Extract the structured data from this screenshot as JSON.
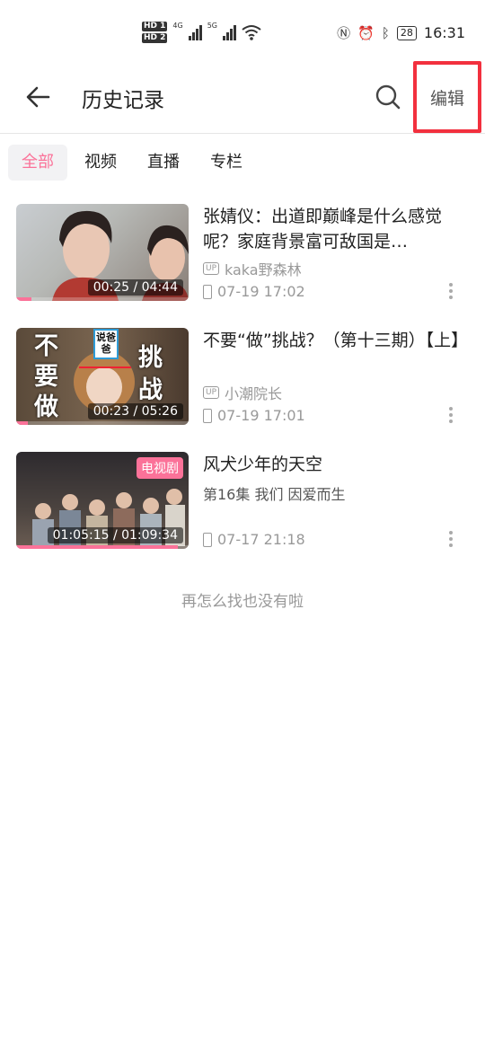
{
  "status_bar": {
    "hd1": "HD 1",
    "hd2": "HD 2",
    "net1": "4G",
    "net2": "5G",
    "battery": "28",
    "time": "16:31",
    "icons": [
      "nfc-icon",
      "alarm-icon",
      "bluetooth-icon",
      "battery-icon",
      "wifi-icon",
      "signal-icon"
    ]
  },
  "header": {
    "title": "历史记录",
    "edit_label": "编辑",
    "highlight_color": "#f2303e"
  },
  "tabs": [
    {
      "label": "全部",
      "active": true
    },
    {
      "label": "视频",
      "active": false
    },
    {
      "label": "直播",
      "active": false
    },
    {
      "label": "专栏",
      "active": false
    }
  ],
  "accent_color": "#fb7299",
  "history": [
    {
      "title": "张婧仪：出道即巅峰是什么感觉呢？家庭背景富可敌国是…",
      "uploader": "kaka野森林",
      "time": "07-19 17:02",
      "duration": "00:25 / 04:44",
      "progress": 0.09
    },
    {
      "title": "不要“做”挑战？（第十三期）【上】",
      "uploader": "小潮院长",
      "time": "07-19 17:01",
      "duration": "00:23 / 05:26",
      "progress": 0.07,
      "thumb_text": {
        "left": "不要做",
        "right": "挑战",
        "tag": "说爸爸"
      }
    },
    {
      "title": "风犬少年的天空",
      "episode": "第16集 我们 因爱而生",
      "time": "07-17 21:18",
      "duration": "01:05:15 / 01:09:34",
      "progress": 0.94,
      "badge": "电视剧"
    }
  ],
  "end_text": "再怎么找也没有啦"
}
